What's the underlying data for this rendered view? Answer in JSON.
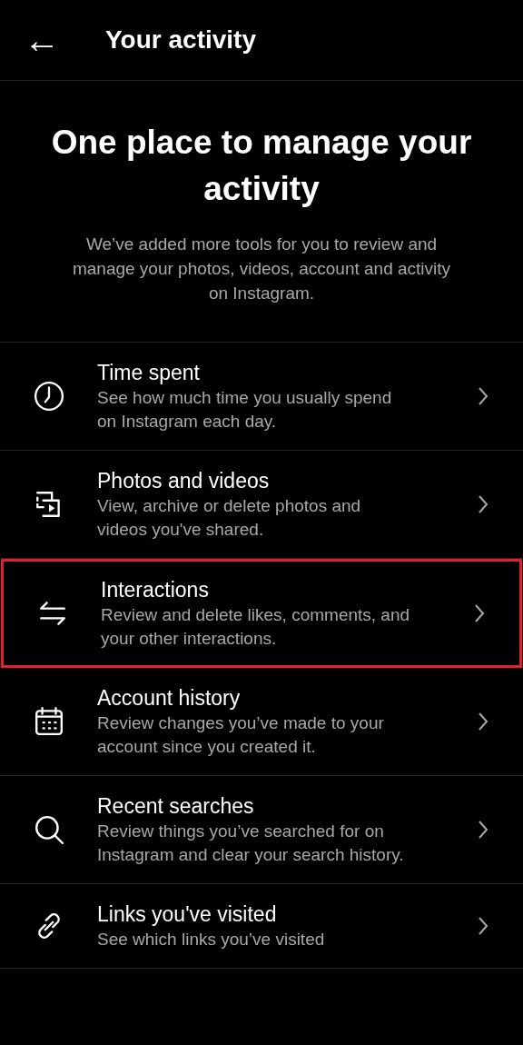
{
  "header": {
    "back_icon": "←",
    "title": "Your activity"
  },
  "intro": {
    "heading": "One place to manage your activity",
    "text": "We’ve added more tools for you to review and manage your photos, videos, account and activity on Instagram."
  },
  "items": [
    {
      "title": "Time spent",
      "description": "See how much time you usually spend on Instagram each day.",
      "highlighted": false
    },
    {
      "title": "Photos and videos",
      "description": "View, archive or delete photos and videos you've shared.",
      "highlighted": false
    },
    {
      "title": "Interactions",
      "description": "Review and delete likes, comments, and your other interactions.",
      "highlighted": true
    },
    {
      "title": "Account history",
      "description": "Review changes you’ve made to your account since you created it.",
      "highlighted": false
    },
    {
      "title": "Recent searches",
      "description": "Review things you’ve searched for on Instagram and clear your search history.",
      "highlighted": false
    },
    {
      "title": "Links you've visited",
      "description": "See which links you’ve visited",
      "highlighted": false
    }
  ]
}
